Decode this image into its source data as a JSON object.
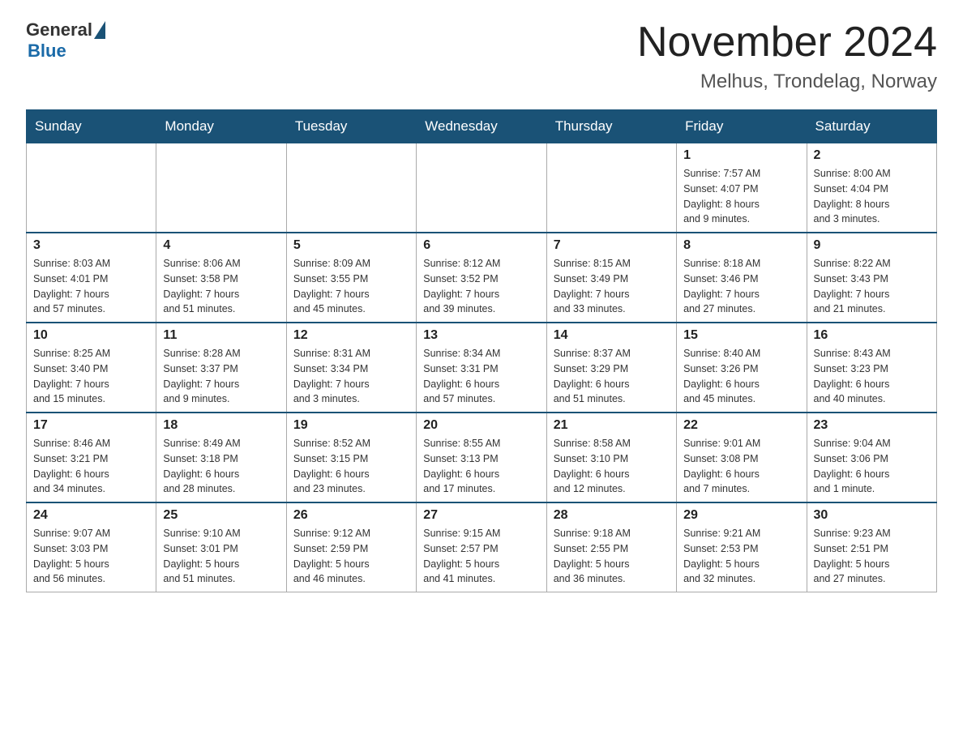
{
  "logo": {
    "general": "General",
    "blue": "Blue"
  },
  "title": "November 2024",
  "location": "Melhus, Trondelag, Norway",
  "days_of_week": [
    "Sunday",
    "Monday",
    "Tuesday",
    "Wednesday",
    "Thursday",
    "Friday",
    "Saturday"
  ],
  "weeks": [
    [
      {
        "num": "",
        "info": ""
      },
      {
        "num": "",
        "info": ""
      },
      {
        "num": "",
        "info": ""
      },
      {
        "num": "",
        "info": ""
      },
      {
        "num": "",
        "info": ""
      },
      {
        "num": "1",
        "info": "Sunrise: 7:57 AM\nSunset: 4:07 PM\nDaylight: 8 hours\nand 9 minutes."
      },
      {
        "num": "2",
        "info": "Sunrise: 8:00 AM\nSunset: 4:04 PM\nDaylight: 8 hours\nand 3 minutes."
      }
    ],
    [
      {
        "num": "3",
        "info": "Sunrise: 8:03 AM\nSunset: 4:01 PM\nDaylight: 7 hours\nand 57 minutes."
      },
      {
        "num": "4",
        "info": "Sunrise: 8:06 AM\nSunset: 3:58 PM\nDaylight: 7 hours\nand 51 minutes."
      },
      {
        "num": "5",
        "info": "Sunrise: 8:09 AM\nSunset: 3:55 PM\nDaylight: 7 hours\nand 45 minutes."
      },
      {
        "num": "6",
        "info": "Sunrise: 8:12 AM\nSunset: 3:52 PM\nDaylight: 7 hours\nand 39 minutes."
      },
      {
        "num": "7",
        "info": "Sunrise: 8:15 AM\nSunset: 3:49 PM\nDaylight: 7 hours\nand 33 minutes."
      },
      {
        "num": "8",
        "info": "Sunrise: 8:18 AM\nSunset: 3:46 PM\nDaylight: 7 hours\nand 27 minutes."
      },
      {
        "num": "9",
        "info": "Sunrise: 8:22 AM\nSunset: 3:43 PM\nDaylight: 7 hours\nand 21 minutes."
      }
    ],
    [
      {
        "num": "10",
        "info": "Sunrise: 8:25 AM\nSunset: 3:40 PM\nDaylight: 7 hours\nand 15 minutes."
      },
      {
        "num": "11",
        "info": "Sunrise: 8:28 AM\nSunset: 3:37 PM\nDaylight: 7 hours\nand 9 minutes."
      },
      {
        "num": "12",
        "info": "Sunrise: 8:31 AM\nSunset: 3:34 PM\nDaylight: 7 hours\nand 3 minutes."
      },
      {
        "num": "13",
        "info": "Sunrise: 8:34 AM\nSunset: 3:31 PM\nDaylight: 6 hours\nand 57 minutes."
      },
      {
        "num": "14",
        "info": "Sunrise: 8:37 AM\nSunset: 3:29 PM\nDaylight: 6 hours\nand 51 minutes."
      },
      {
        "num": "15",
        "info": "Sunrise: 8:40 AM\nSunset: 3:26 PM\nDaylight: 6 hours\nand 45 minutes."
      },
      {
        "num": "16",
        "info": "Sunrise: 8:43 AM\nSunset: 3:23 PM\nDaylight: 6 hours\nand 40 minutes."
      }
    ],
    [
      {
        "num": "17",
        "info": "Sunrise: 8:46 AM\nSunset: 3:21 PM\nDaylight: 6 hours\nand 34 minutes."
      },
      {
        "num": "18",
        "info": "Sunrise: 8:49 AM\nSunset: 3:18 PM\nDaylight: 6 hours\nand 28 minutes."
      },
      {
        "num": "19",
        "info": "Sunrise: 8:52 AM\nSunset: 3:15 PM\nDaylight: 6 hours\nand 23 minutes."
      },
      {
        "num": "20",
        "info": "Sunrise: 8:55 AM\nSunset: 3:13 PM\nDaylight: 6 hours\nand 17 minutes."
      },
      {
        "num": "21",
        "info": "Sunrise: 8:58 AM\nSunset: 3:10 PM\nDaylight: 6 hours\nand 12 minutes."
      },
      {
        "num": "22",
        "info": "Sunrise: 9:01 AM\nSunset: 3:08 PM\nDaylight: 6 hours\nand 7 minutes."
      },
      {
        "num": "23",
        "info": "Sunrise: 9:04 AM\nSunset: 3:06 PM\nDaylight: 6 hours\nand 1 minute."
      }
    ],
    [
      {
        "num": "24",
        "info": "Sunrise: 9:07 AM\nSunset: 3:03 PM\nDaylight: 5 hours\nand 56 minutes."
      },
      {
        "num": "25",
        "info": "Sunrise: 9:10 AM\nSunset: 3:01 PM\nDaylight: 5 hours\nand 51 minutes."
      },
      {
        "num": "26",
        "info": "Sunrise: 9:12 AM\nSunset: 2:59 PM\nDaylight: 5 hours\nand 46 minutes."
      },
      {
        "num": "27",
        "info": "Sunrise: 9:15 AM\nSunset: 2:57 PM\nDaylight: 5 hours\nand 41 minutes."
      },
      {
        "num": "28",
        "info": "Sunrise: 9:18 AM\nSunset: 2:55 PM\nDaylight: 5 hours\nand 36 minutes."
      },
      {
        "num": "29",
        "info": "Sunrise: 9:21 AM\nSunset: 2:53 PM\nDaylight: 5 hours\nand 32 minutes."
      },
      {
        "num": "30",
        "info": "Sunrise: 9:23 AM\nSunset: 2:51 PM\nDaylight: 5 hours\nand 27 minutes."
      }
    ]
  ]
}
